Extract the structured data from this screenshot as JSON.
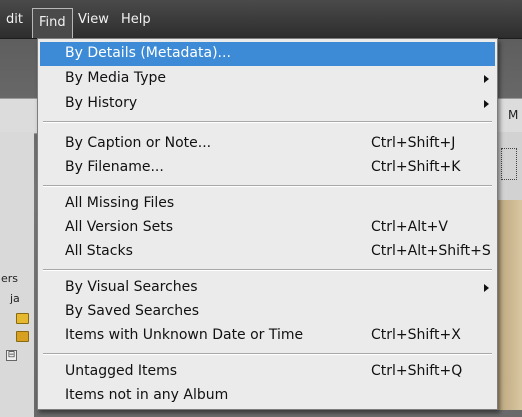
{
  "menubar": {
    "items": [
      "dit",
      "Find",
      "View",
      "Help"
    ],
    "active": "Find"
  },
  "background": {
    "fragment_right": "M",
    "fragment_left_1": "ers",
    "fragment_left_2": "ja",
    "minus": "⊟"
  },
  "find_menu": {
    "items": [
      {
        "label": "By Details (Metadata)...",
        "shortcut": "",
        "submenu": false,
        "highlighted": true
      },
      {
        "label": "By Media Type",
        "shortcut": "",
        "submenu": true,
        "highlighted": false
      },
      {
        "label": "By History",
        "shortcut": "",
        "submenu": true,
        "highlighted": false
      },
      {
        "label": "By Caption or Note...",
        "shortcut": "Ctrl+Shift+J",
        "submenu": false,
        "highlighted": false
      },
      {
        "label": "By Filename...",
        "shortcut": "Ctrl+Shift+K",
        "submenu": false,
        "highlighted": false
      },
      {
        "label": "All Missing Files",
        "shortcut": "",
        "submenu": false,
        "highlighted": false
      },
      {
        "label": "All Version Sets",
        "shortcut": "Ctrl+Alt+V",
        "submenu": false,
        "highlighted": false
      },
      {
        "label": "All Stacks",
        "shortcut": "Ctrl+Alt+Shift+S",
        "submenu": false,
        "highlighted": false
      },
      {
        "label": "By Visual Searches",
        "shortcut": "",
        "submenu": true,
        "highlighted": false
      },
      {
        "label": "By Saved Searches",
        "shortcut": "",
        "submenu": false,
        "highlighted": false
      },
      {
        "label": "Items with Unknown Date or Time",
        "shortcut": "Ctrl+Shift+X",
        "submenu": false,
        "highlighted": false
      },
      {
        "label": "Untagged Items",
        "shortcut": "Ctrl+Shift+Q",
        "submenu": false,
        "highlighted": false
      },
      {
        "label": "Items not in any Album",
        "shortcut": "",
        "submenu": false,
        "highlighted": false
      }
    ],
    "highlight_color": "#3d8bd6"
  }
}
